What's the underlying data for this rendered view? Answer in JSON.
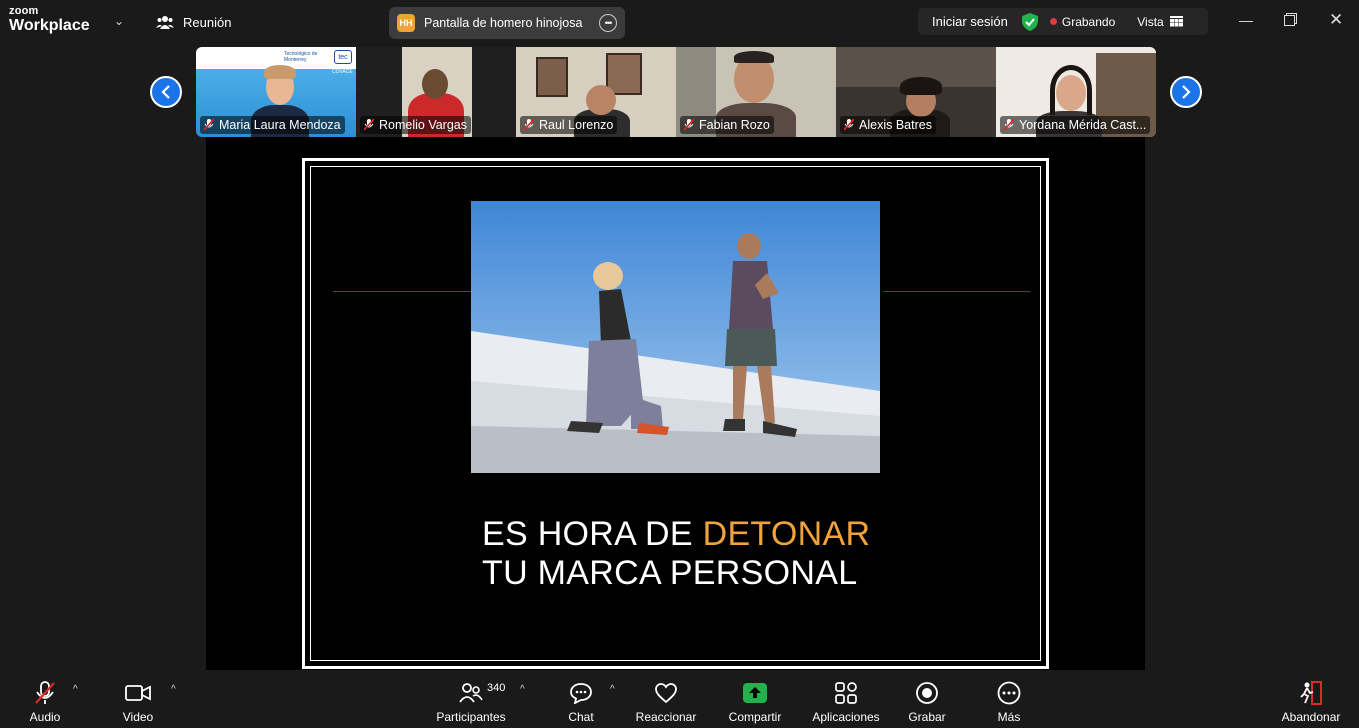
{
  "app": {
    "logo_line1": "zoom",
    "logo_line2": "Workplace",
    "meeting_label": "Reunión"
  },
  "share": {
    "badge": "HH",
    "title": "Pantalla de homero hinojosa"
  },
  "topright": {
    "login": "Iniciar sesión",
    "recording": "Grabando",
    "view": "Vista"
  },
  "participants_strip": [
    {
      "name": "Maria Laura Mendoza",
      "muted": true
    },
    {
      "name": "Romelio Vargas",
      "muted": true
    },
    {
      "name": "Raul Lorenzo",
      "muted": true
    },
    {
      "name": "Fabian Rozo",
      "muted": true
    },
    {
      "name": "Alexis Batres",
      "muted": true
    },
    {
      "name": "Yordana Mérida Cast...",
      "muted": true
    }
  ],
  "tile1_logos": {
    "brand": "Tecnológico de Monterrey",
    "badge": "tec",
    "small": "COVACE"
  },
  "slide": {
    "line1_prefix": "ES HORA DE ",
    "line1_accent": "DETONAR",
    "line2": "TU MARCA PERSONAL"
  },
  "toolbar": {
    "audio": "Audio",
    "video": "Video",
    "participants": "Participantes",
    "participants_count": "340",
    "chat": "Chat",
    "react": "Reaccionar",
    "share": "Compartir",
    "apps": "Aplicaciones",
    "record": "Grabar",
    "more": "Más",
    "leave": "Abandonar"
  },
  "colors": {
    "accent_blue": "#1a73e8",
    "share_green": "#22b14c",
    "slide_accent": "#f0a33a",
    "recording_red": "#e23c3c",
    "leave_red": "#e02828"
  }
}
